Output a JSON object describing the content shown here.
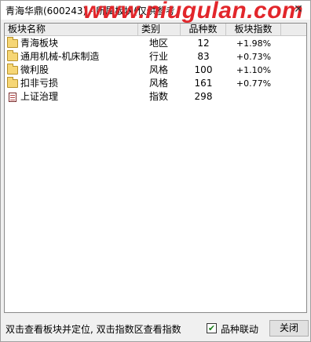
{
  "window": {
    "title": "青海华鼎(600243) - 所属板块(仅供参考",
    "watermark": "www.niugulan.com",
    "close_glyph": "✕"
  },
  "table": {
    "columns": [
      "板块名称",
      "类别",
      "品种数",
      "板块指数",
      ""
    ],
    "rows": [
      {
        "icon": "folder",
        "name": "青海板块",
        "type": "地区",
        "count": "12",
        "index": "+1.98%"
      },
      {
        "icon": "folder",
        "name": "通用机械-机床制造",
        "type": "行业",
        "count": "83",
        "index": "+0.73%"
      },
      {
        "icon": "folder",
        "name": "微利股",
        "type": "风格",
        "count": "100",
        "index": "+1.10%"
      },
      {
        "icon": "folder",
        "name": "扣非亏损",
        "type": "风格",
        "count": "161",
        "index": "+0.77%"
      },
      {
        "icon": "doc",
        "name": "上证治理",
        "type": "指数",
        "count": "298",
        "index": ""
      }
    ]
  },
  "footer": {
    "hint": "双击查看板块并定位, 双击指数区查看指数",
    "checkbox_label": "品种联动",
    "checkbox_checked": true,
    "check_glyph": "✔",
    "close_label": "关闭"
  }
}
